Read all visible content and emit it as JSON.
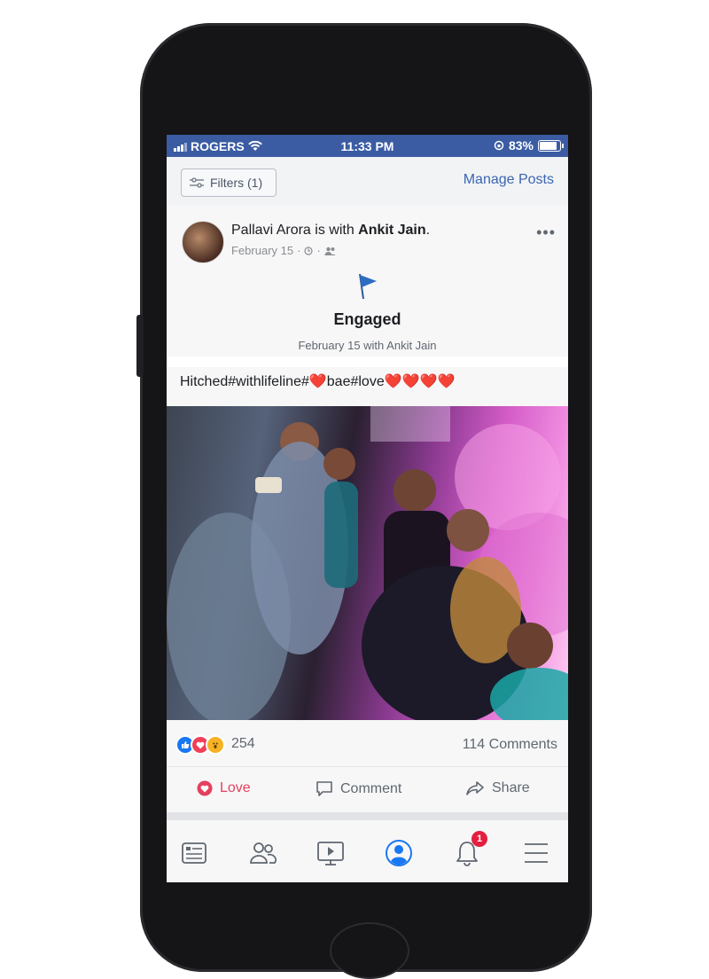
{
  "status_bar": {
    "carrier": "ROGERS",
    "time": "11:33 PM",
    "battery": "83%"
  },
  "toolbar": {
    "filters_label": "Filters (1)",
    "manage_posts_label": "Manage Posts"
  },
  "post": {
    "author": "Pallavi Arora",
    "with_text": " is with ",
    "tagged": "Ankit Jain",
    "period": ".",
    "date": "February 15",
    "life_event_title": "Engaged",
    "life_event_sub": "February 15 with Ankit Jain",
    "caption": "Hitched#withlifeline#❤️bae#love❤️❤️❤️❤️",
    "reaction_count": "254",
    "comments_count": "114 Comments"
  },
  "actions": {
    "love": "Love",
    "comment": "Comment",
    "share": "Share"
  },
  "tabs": [
    "news-feed",
    "friends",
    "watch",
    "profile",
    "notifications",
    "menu"
  ],
  "notifications_badge": "1",
  "colors": {
    "brand_blue": "#3b5ca3",
    "love_red": "#e4405f",
    "link_blue": "#3b65b3"
  }
}
